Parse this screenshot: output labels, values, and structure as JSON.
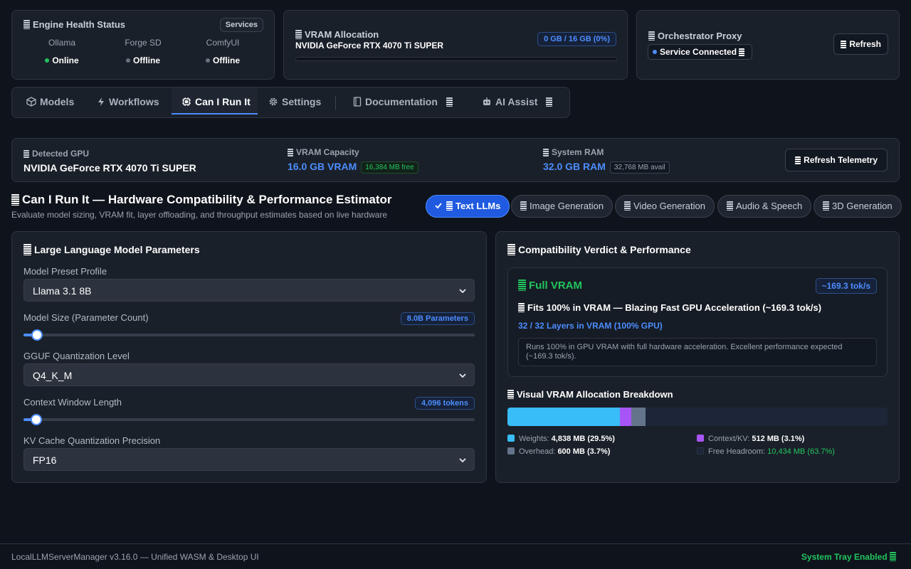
{
  "engine": {
    "title": "Engine Health Status",
    "services_button": "Services",
    "items": [
      {
        "name": "Ollama",
        "status": "Online",
        "color": "#22c55e"
      },
      {
        "name": "Forge SD",
        "status": "Offline",
        "color": "#6b7280"
      },
      {
        "name": "ComfyUI",
        "status": "Offline",
        "color": "#6b7280"
      }
    ]
  },
  "vram_alloc": {
    "title": "VRAM Allocation",
    "gpu": "NVIDIA GeForce RTX 4070 Ti SUPER",
    "badge": "0 GB / 16 GB (0%)",
    "fraction": 0
  },
  "orchestrator": {
    "title": "Orchestrator Proxy",
    "status": "Service Connected",
    "refresh": "Refresh"
  },
  "tabs": [
    {
      "label": "Models",
      "icon": "cube-icon"
    },
    {
      "label": "Workflows",
      "icon": "bolt-icon"
    },
    {
      "label": "Can I Run It",
      "icon": "chip-icon",
      "active": true
    },
    {
      "label": "Settings",
      "icon": "gear-icon"
    },
    {
      "label": "Documentation",
      "icon": "book-icon"
    },
    {
      "label": "AI Assist",
      "icon": "robot-icon"
    }
  ],
  "telemetry": {
    "gpu_label": "Detected GPU",
    "gpu_value": "NVIDIA GeForce RTX 4070 Ti SUPER",
    "vram_label": "VRAM Capacity",
    "vram_value": "16.0 GB VRAM",
    "vram_free": "16,384 MB free",
    "ram_label": "System RAM",
    "ram_value": "32.0 GB RAM",
    "ram_avail": "32,768 MB avail",
    "refresh": "Refresh Telemetry"
  },
  "section": {
    "title": "Can I Run It — Hardware Compatibility & Performance Estimator",
    "subtitle": "Evaluate model sizing, VRAM fit, layer offloading, and throughput estimates based on live hardware"
  },
  "categories": [
    {
      "label": "Text LLMs",
      "active": true
    },
    {
      "label": "Image Generation"
    },
    {
      "label": "Video Generation"
    },
    {
      "label": "Audio & Speech"
    },
    {
      "label": "3D Generation"
    }
  ],
  "params": {
    "title": "Large Language Model Parameters",
    "preset_label": "Model Preset Profile",
    "preset_value": "Llama 3.1 8B",
    "size_label": "Model Size (Parameter Count)",
    "size_badge": "8.0B Parameters",
    "size_fraction": 0.03,
    "quant_label": "GGUF Quantization Level",
    "quant_value": "Q4_K_M",
    "ctx_label": "Context Window Length",
    "ctx_badge": "4,096 tokens",
    "ctx_fraction": 0.028,
    "kv_label": "KV Cache Quantization Precision",
    "kv_value": "FP16"
  },
  "verdict": {
    "title": "Compatibility Verdict & Performance",
    "status": "Full VRAM",
    "speed": "~169.3 tok/s",
    "fits": "Fits 100% in VRAM — Blazing Fast GPU Acceleration (~169.3 tok/s)",
    "layers": "32 / 32 Layers in VRAM (100% GPU)",
    "note": "Runs 100% in GPU VRAM with full hardware acceleration. Excellent performance expected (~169.3 tok/s).",
    "breakdown_title": "Visual VRAM Allocation Breakdown",
    "segments": [
      {
        "label": "Weights:",
        "value": "4,838 MB (29.5%)",
        "pct": 29.5,
        "color": "#38bdf8"
      },
      {
        "label": "Context/KV:",
        "value": "512 MB (3.1%)",
        "pct": 3.1,
        "color": "#a855f7"
      },
      {
        "label": "Overhead:",
        "value": "600 MB (3.7%)",
        "pct": 3.7,
        "color": "#64748b"
      },
      {
        "label": "Free Headroom:",
        "value": "10,434 MB (63.7%)",
        "pct": 63.7,
        "color": "#1c2638"
      }
    ]
  },
  "footer": {
    "left": "LocalLLMServerManager v3.16.0 — Unified WASM & Desktop UI",
    "right": "System Tray Enabled"
  }
}
